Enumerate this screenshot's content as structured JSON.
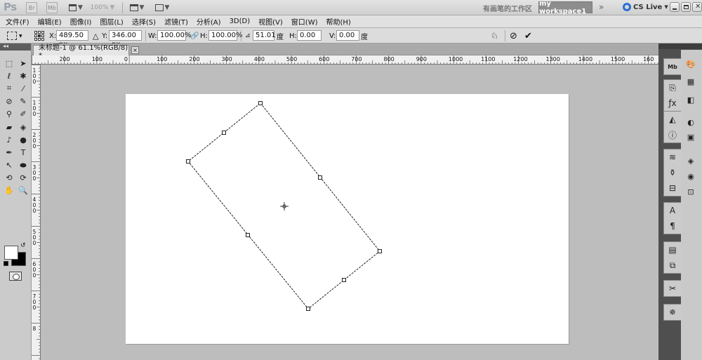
{
  "app": {
    "logo": "Ps",
    "zoom_value": "100%",
    "workspace_label": "有画笔的工作区",
    "workspace_button": "my workspace1",
    "more_chevron": "»",
    "cs_live": "CS Live"
  },
  "menu": [
    "文件(F)",
    "编辑(E)",
    "图像(I)",
    "图层(L)",
    "选择(S)",
    "滤镜(T)",
    "分析(A)",
    "3D(D)",
    "视图(V)",
    "窗口(W)",
    "帮助(H)"
  ],
  "options": {
    "x_label": "X:",
    "x_value": "489.50 px",
    "y_label": "Y:",
    "y_value": "346.00 px",
    "w_label": "W:",
    "w_value": "100.00%",
    "h_label": "H:",
    "h_value": "100.00%",
    "angle_value": "51.01",
    "angle_unit": "度",
    "skew_h_label": "H:",
    "skew_h_value": "0.00",
    "skew_v_label": "V:",
    "skew_v_value": "0.00",
    "skew_unit": "度"
  },
  "document": {
    "tab_title": "未标题-1 @ 61.1%(RGB/8) *",
    "tab_close": "×"
  },
  "ruler": {
    "h_labels": [
      "200",
      "100",
      "0",
      "100",
      "200",
      "300",
      "400",
      "500",
      "600",
      "700",
      "800",
      "900",
      "1000",
      "1100",
      "1200",
      "1300",
      "1400",
      "1500",
      "160"
    ],
    "v_labels": [
      "1",
      "0",
      "0",
      "1",
      "0",
      "0",
      "2",
      "0",
      "0",
      "3",
      "0",
      "0",
      "4",
      "0",
      "0",
      "5",
      "0",
      "0",
      "6",
      "0",
      "0",
      "7",
      "0",
      "0",
      "8"
    ]
  },
  "toolbox": {
    "tools": [
      "marquee-icon",
      "move-icon",
      "lasso-icon",
      "magic-wand-icon",
      "crop-icon",
      "eyedropper-icon",
      "spot-heal-icon",
      "brush-icon",
      "clone-stamp-icon",
      "history-brush-icon",
      "eraser-icon",
      "paint-bucket-icon",
      "blur-icon",
      "dodge-icon",
      "pen-icon",
      "type-icon",
      "path-select-icon",
      "ellipse-icon",
      "3d-rotate-icon",
      "3d-orbit-icon",
      "hand-icon",
      "zoom-icon"
    ]
  },
  "dock": {
    "col1": [
      "mini-bridge-icon",
      "history-icon",
      "color-icon",
      "info-icon",
      "brush-presets-icon",
      "clone-source-icon",
      "tool-presets-icon",
      "character-icon",
      "paragraph-icon",
      "layer-comps-icon",
      "actions-icon",
      "navigator-icon",
      "3d-icon"
    ],
    "col2": [
      "color-panel-icon",
      "swatches-icon",
      "styles-icon",
      "adjustments-icon",
      "masks-icon",
      "layers-icon",
      "channels-icon",
      "paths-icon"
    ]
  }
}
